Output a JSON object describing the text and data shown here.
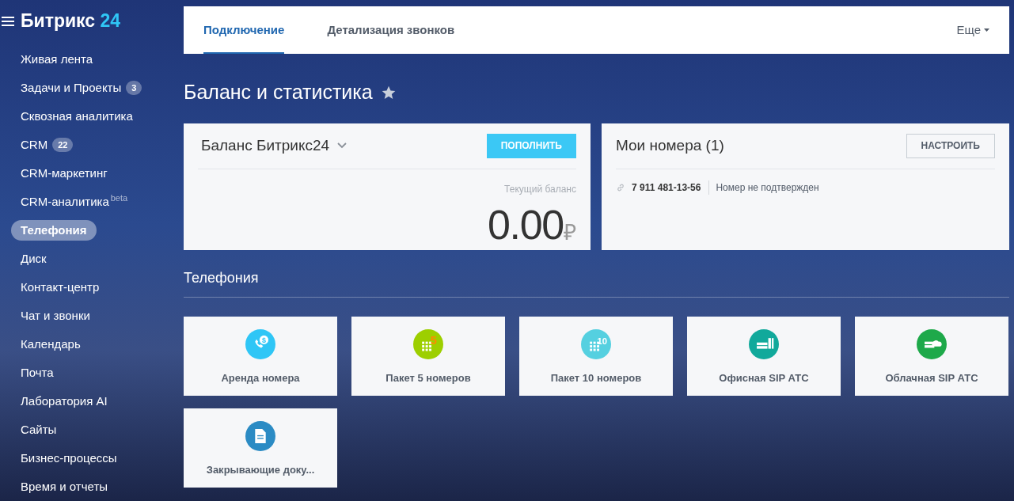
{
  "sidebar": {
    "logo": {
      "name": "Битрикс",
      "suffix": "24"
    },
    "items": [
      {
        "label": "Живая лента",
        "selected": false
      },
      {
        "label": "Задачи и Проекты",
        "counter": "3",
        "selected": false
      },
      {
        "label": "Сквозная аналитика",
        "selected": false
      },
      {
        "label": "CRM",
        "counter": "22",
        "selected": false
      },
      {
        "label": "CRM-маркетинг",
        "selected": false
      },
      {
        "label": "CRM-аналитика",
        "sup": "beta",
        "selected": false
      },
      {
        "label": "Телефония",
        "selected": true
      },
      {
        "label": "Диск",
        "selected": false
      },
      {
        "label": "Контакт-центр",
        "selected": false
      },
      {
        "label": "Чат и звонки",
        "selected": false
      },
      {
        "label": "Календарь",
        "selected": false
      },
      {
        "label": "Почта",
        "selected": false
      },
      {
        "label": "Лаборатория AI",
        "selected": false
      },
      {
        "label": "Сайты",
        "selected": false
      },
      {
        "label": "Бизнес-процессы",
        "selected": false
      },
      {
        "label": "Время и отчеты",
        "selected": false
      }
    ]
  },
  "tabs": [
    {
      "label": "Подключение",
      "selected": true
    },
    {
      "label": "Детализация звонков",
      "selected": false
    }
  ],
  "more_menu": "Еще",
  "page_title": "Баланс и статистика",
  "balance_card": {
    "title": "Баланс Битрикс24",
    "button": "ПОПОЛНИТЬ",
    "caption": "Текущий баланс",
    "amount": "0.00",
    "currency": "₽"
  },
  "numbers_card": {
    "title": "Мои номера (1)",
    "button": "НАСТРОИТЬ",
    "numbers": [
      {
        "number": "7 911 481-13-56",
        "status": "Номер не подтвержден"
      }
    ]
  },
  "section_title": "Телефония",
  "tiles": [
    {
      "kind": "rent",
      "label": "Аренда номера",
      "color": "#2fc6f6",
      "icon_text": "$"
    },
    {
      "kind": "pack",
      "label": "Пакет 5 номеров",
      "color": "#9dcf00",
      "icon_text": "5"
    },
    {
      "kind": "pack",
      "label": "Пакет 10 номеров",
      "color": "#55d0e0",
      "icon_text": "10"
    },
    {
      "kind": "office",
      "label": "Офисная SIP АТС",
      "color": "#11a99b"
    },
    {
      "kind": "cloud",
      "label": "Облачная SIP АТС",
      "color": "#1ea94a"
    },
    {
      "kind": "doc",
      "label": "Закрывающие доку...",
      "color": "#2b8bc4"
    }
  ]
}
